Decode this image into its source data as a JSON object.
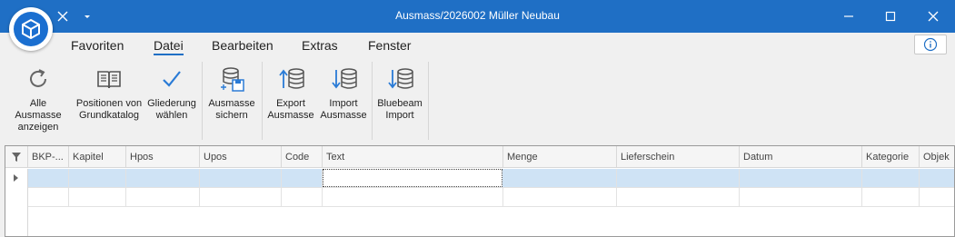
{
  "window": {
    "title": "Ausmass/2026002 Müller Neubau"
  },
  "menu": {
    "tabs": [
      "Favoriten",
      "Datei",
      "Bearbeiten",
      "Extras",
      "Fenster"
    ],
    "active": "Datei"
  },
  "ribbon": {
    "buttons": [
      {
        "line1": "Alle Ausmasse",
        "line2": "anzeigen",
        "icon": "refresh-icon"
      },
      {
        "line1": "Positionen von",
        "line2": "Grundkatalog",
        "icon": "catalog-book-icon"
      },
      {
        "line1": "Gliederung",
        "line2": "wählen",
        "icon": "checkmark-icon"
      },
      {
        "line1": "Ausmasse",
        "line2": "sichern",
        "icon": "database-save-icon"
      },
      {
        "line1": "Export",
        "line2": "Ausmasse",
        "icon": "database-export-icon"
      },
      {
        "line1": "Import",
        "line2": "Ausmasse",
        "icon": "database-import-icon"
      },
      {
        "line1": "Bluebeam",
        "line2": "Import",
        "icon": "database-import-icon"
      }
    ]
  },
  "grid": {
    "columns": [
      "BKP-...",
      "Kapitel",
      "Hpos",
      "Upos",
      "Code",
      "Text",
      "Menge",
      "Lieferschein",
      "Datum",
      "Kategorie",
      "Objek"
    ]
  },
  "colors": {
    "titlebar": "#1f6fc5",
    "accent": "#1b6fd0",
    "selected_row": "#cfe3f5"
  }
}
